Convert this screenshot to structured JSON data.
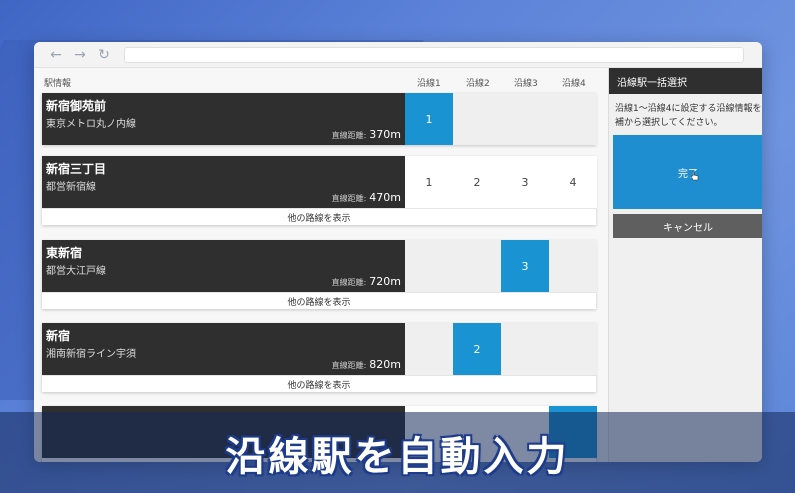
{
  "header": {
    "station_info": "駅情報",
    "cols": [
      "沿線1",
      "沿線2",
      "沿線3",
      "沿線4"
    ]
  },
  "distance_label": "直線距離:",
  "stations": [
    {
      "name": "新宿御苑前",
      "line": "東京メトロ丸ノ内線",
      "distance": "370m",
      "slot_text": [
        "1",
        "",
        "",
        ""
      ],
      "selected": 0,
      "show_more": false
    },
    {
      "name": "新宿三丁目",
      "line": "都営新宿線",
      "distance": "470m",
      "slot_text": [
        "1",
        "2",
        "3",
        "4"
      ],
      "selected": -1,
      "show_more": true
    },
    {
      "name": "東新宿",
      "line": "都営大江戸線",
      "distance": "720m",
      "slot_text": [
        "",
        "",
        "3",
        ""
      ],
      "selected": 2,
      "show_more": true
    },
    {
      "name": "新宿",
      "line": "湘南新宿ライン宇須",
      "distance": "820m",
      "slot_text": [
        "",
        "2",
        "",
        ""
      ],
      "selected": 1,
      "show_more": true
    }
  ],
  "more_label": "他の路線を表示",
  "panel": {
    "title": "沿線駅一括選択",
    "desc_line1": "沿線1～沿線4に設定する沿線情報を",
    "desc_line2": "補から選択してください。",
    "done_label": "完了",
    "cancel_label": "キャンセル"
  },
  "caption": "沿線駅を自動入力",
  "colors": {
    "selected": "#1a93d3",
    "dark": "#2f2f2f",
    "done": "#1f8ed0"
  }
}
